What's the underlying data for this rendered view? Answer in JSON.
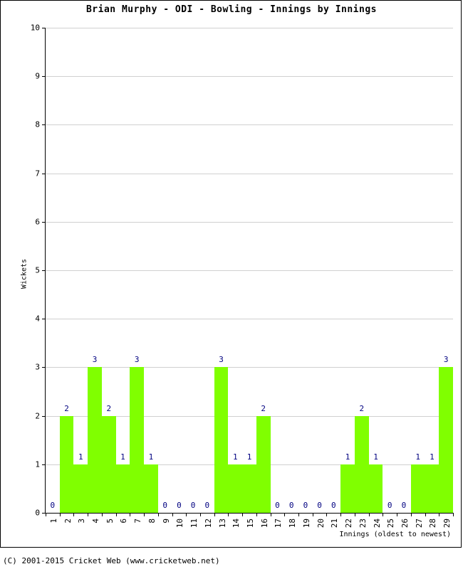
{
  "chart_data": {
    "type": "bar",
    "title": "Brian Murphy - ODI - Bowling - Innings by Innings",
    "xlabel": "Innings (oldest to newest)",
    "ylabel": "Wickets",
    "categories": [
      "1",
      "2",
      "3",
      "4",
      "5",
      "6",
      "7",
      "8",
      "9",
      "10",
      "11",
      "12",
      "13",
      "14",
      "15",
      "16",
      "17",
      "18",
      "19",
      "20",
      "21",
      "22",
      "23",
      "24",
      "25",
      "26",
      "27",
      "28",
      "29"
    ],
    "values": [
      0,
      2,
      1,
      3,
      2,
      1,
      3,
      1,
      0,
      0,
      0,
      0,
      3,
      1,
      1,
      2,
      0,
      0,
      0,
      0,
      0,
      1,
      2,
      1,
      0,
      0,
      1,
      1,
      3
    ],
    "ylim": [
      0,
      10
    ],
    "yticks": [
      0,
      1,
      2,
      3,
      4,
      5,
      6,
      7,
      8,
      9,
      10
    ],
    "grid": true,
    "legend": "none",
    "bar_color": "#80ff00",
    "label_color": "#000080",
    "grid_color": "#d0d0d0"
  },
  "footer": {
    "copyright": "(C) 2001-2015 Cricket Web (www.cricketweb.net)"
  }
}
